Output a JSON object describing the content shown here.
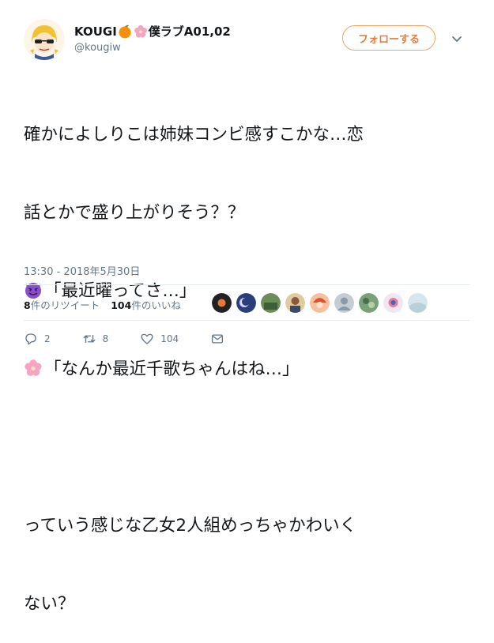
{
  "tweet": {
    "author": {
      "display_name_prefix": "KOUGI",
      "display_name_suffix": "僕ラブA01,02",
      "handle": "@kougiw"
    },
    "follow_label": "フォローする",
    "lines": [
      "確かによしりこは姉妹コンビ感すこかな…恋",
      "話とかで盛り上がりそう？？",
      "「最近曜ってさ…」",
      "「なんか最近千歌ちゃんはね…」",
      "",
      "っていう感じな乙女2人組めっちゃかわいく",
      "ない？"
    ],
    "line_emojis": {
      "2": "smiling-devil-icon",
      "3": "cherry-blossom-icon"
    },
    "timestamp": "13:30 - 2018年5月30日",
    "retweets_count": "8",
    "retweets_label": "件のリツイート",
    "likes_count": "104",
    "likes_label": "件のいいね",
    "reply_count": "2",
    "retweet_action_count": "8",
    "like_action_count": "104"
  },
  "colors": {
    "accent": "#e8793a",
    "muted": "#657786",
    "text": "#14171a",
    "devil": "#8a4fc8",
    "blossom": "#f6a5c0"
  }
}
